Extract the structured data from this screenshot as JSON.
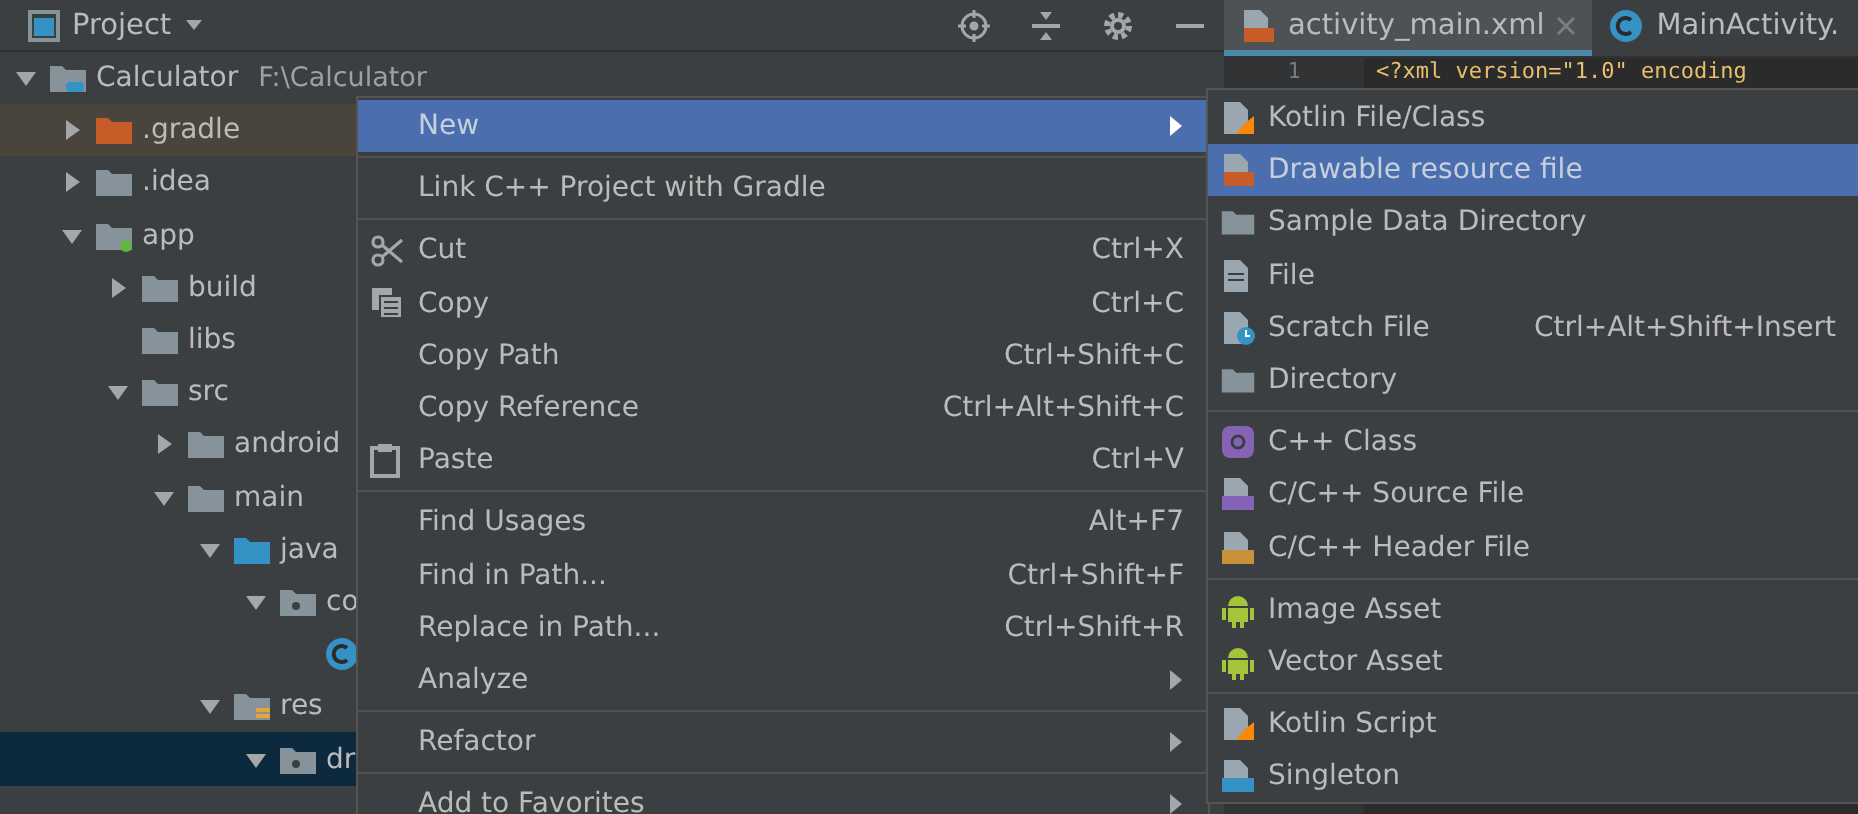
{
  "project_panel": {
    "title": "Project"
  },
  "tree": [
    {
      "label": "Calculator",
      "path": "F:\\Calculator",
      "kind": "project",
      "expanded": true,
      "selected": false,
      "children": [
        {
          "label": ".gradle",
          "kind": "excluded",
          "expanded": false,
          "selected": false,
          "highlighted": true
        },
        {
          "label": ".idea",
          "kind": "folder",
          "expanded": false,
          "selected": false
        },
        {
          "label": "app",
          "kind": "module",
          "expanded": true,
          "selected": false,
          "children": [
            {
              "label": "build",
              "kind": "folder",
              "expanded": false,
              "selected": false
            },
            {
              "label": "libs",
              "kind": "folder",
              "selected": false
            },
            {
              "label": "src",
              "kind": "folder",
              "expanded": true,
              "selected": false,
              "children": [
                {
                  "label": "android",
                  "kind": "folder",
                  "expanded": false,
                  "selected": false
                },
                {
                  "label": "main",
                  "kind": "folder",
                  "expanded": true,
                  "selected": false,
                  "children": [
                    {
                      "label": "java",
                      "kind": "source",
                      "expanded": true,
                      "selected": false,
                      "children": [
                        {
                          "label": "co",
                          "kind": "package",
                          "expanded": true,
                          "selected": false,
                          "children": [
                            {
                              "kind": "class",
                              "selected": false
                            }
                          ]
                        }
                      ]
                    },
                    {
                      "label": "res",
                      "kind": "resources",
                      "expanded": true,
                      "selected": false,
                      "children": [
                        {
                          "label": "dr",
                          "kind": "package",
                          "expanded": true,
                          "selected": true
                        }
                      ]
                    }
                  ]
                }
              ]
            }
          ]
        }
      ]
    }
  ],
  "editor_tabs": [
    {
      "label": "activity_main.xml",
      "kind": "xml",
      "selected": true,
      "closable": true
    },
    {
      "label": "MainActivity.",
      "kind": "class",
      "selected": false,
      "closable": false
    }
  ],
  "editor": {
    "line_number": "1",
    "code": "<?xml version=\"1.0\" encoding"
  },
  "context_menu": [
    {
      "kind": "item",
      "label": "New",
      "selected": true,
      "has_submenu": true
    },
    {
      "kind": "separator"
    },
    {
      "kind": "item",
      "label": "Link C++ Project with Gradle",
      "selected": false,
      "has_submenu": false
    },
    {
      "kind": "separator"
    },
    {
      "kind": "cut",
      "label": "Cut",
      "shortcut": "Ctrl+X",
      "selected": false,
      "has_submenu": false
    },
    {
      "kind": "copy",
      "label": "Copy",
      "shortcut": "Ctrl+C",
      "selected": false,
      "has_submenu": false
    },
    {
      "kind": "item",
      "label": "Copy Path",
      "shortcut": "Ctrl+Shift+C",
      "selected": false,
      "has_submenu": false
    },
    {
      "kind": "item",
      "label": "Copy Reference",
      "shortcut": "Ctrl+Alt+Shift+C",
      "selected": false,
      "has_submenu": false
    },
    {
      "kind": "paste",
      "label": "Paste",
      "shortcut": "Ctrl+V",
      "selected": false,
      "has_submenu": false
    },
    {
      "kind": "separator"
    },
    {
      "kind": "item",
      "label": "Find Usages",
      "shortcut": "Alt+F7",
      "selected": false,
      "has_submenu": false
    },
    {
      "kind": "item",
      "label": "Find in Path...",
      "shortcut": "Ctrl+Shift+F",
      "selected": false,
      "has_submenu": false
    },
    {
      "kind": "item",
      "label": "Replace in Path...",
      "shortcut": "Ctrl+Shift+R",
      "selected": false,
      "has_submenu": false
    },
    {
      "kind": "item",
      "label": "Analyze",
      "selected": false,
      "has_submenu": true
    },
    {
      "kind": "separator"
    },
    {
      "kind": "item",
      "label": "Refactor",
      "selected": false,
      "has_submenu": true
    },
    {
      "kind": "separator"
    },
    {
      "kind": "item",
      "label": "Add to Favorites",
      "selected": false,
      "has_submenu": true
    }
  ],
  "new_submenu": [
    {
      "kind": "kotlin",
      "label": "Kotlin File/Class",
      "selected": false
    },
    {
      "kind": "xml",
      "label": "Drawable resource file",
      "selected": true
    },
    {
      "kind": "folder",
      "label": "Sample Data Directory",
      "selected": false
    },
    {
      "kind": "file",
      "label": "File",
      "selected": false
    },
    {
      "kind": "scratch",
      "label": "Scratch File",
      "shortcut": "Ctrl+Alt+Shift+Insert",
      "selected": false
    },
    {
      "kind": "folder",
      "label": "Directory",
      "selected": false
    },
    {
      "kind": "separator"
    },
    {
      "kind": "cpp-class",
      "label": "C++ Class",
      "selected": false
    },
    {
      "kind": "cpp-source",
      "label": "C/C++ Source File",
      "selected": false
    },
    {
      "kind": "cpp-header",
      "label": "C/C++ Header File",
      "selected": false
    },
    {
      "kind": "separator"
    },
    {
      "kind": "android",
      "label": "Image Asset",
      "selected": false
    },
    {
      "kind": "android",
      "label": "Vector Asset",
      "selected": false
    },
    {
      "kind": "separator"
    },
    {
      "kind": "kotlin",
      "label": "Kotlin Script",
      "selected": false
    },
    {
      "kind": "java",
      "label": "Singleton",
      "selected": false
    }
  ]
}
